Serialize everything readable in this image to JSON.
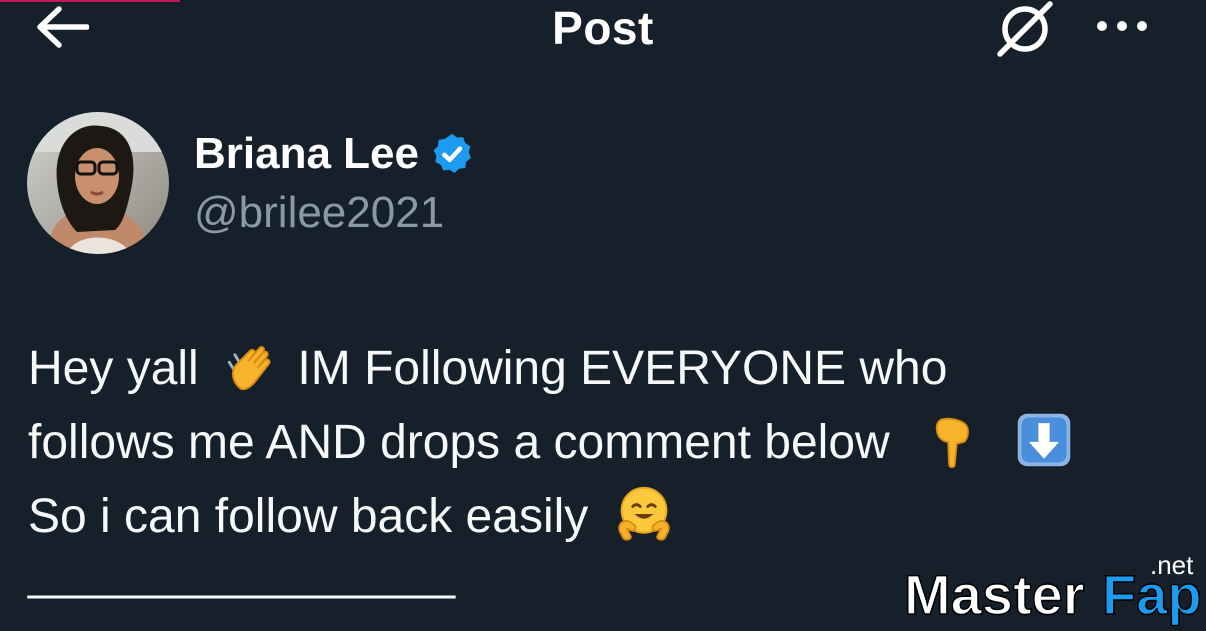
{
  "header": {
    "title": "Post",
    "back_icon": "arrow-left-icon",
    "grok_icon": "grok-icon",
    "more_icon": "more-horizontal-icon"
  },
  "author": {
    "display_name": "Briana Lee",
    "handle": "@brilee2021",
    "verified": true,
    "verified_color": "#1d9bf0"
  },
  "tweet": {
    "line1_a": "Hey yall",
    "line1_emoji": "waving-hand-emoji",
    "line1_b": "IM Following EVERYONE who",
    "line2_a": "follows me AND drops a comment below",
    "line2_emoji1": "pointing-down-emoji",
    "line2_emoji2": "down-arrow-emoji",
    "line3_a": "So i can follow back easily",
    "line3_emoji": "hugging-face-emoji",
    "divider": "________________"
  },
  "watermark": {
    "brand_a": "Master",
    "brand_b": "Fap",
    "tld": ".net"
  },
  "colors": {
    "background": "#15202b",
    "text_primary": "#f7f9f9",
    "text_secondary": "#8b98a5",
    "accent_blue": "#1d9bf0"
  }
}
